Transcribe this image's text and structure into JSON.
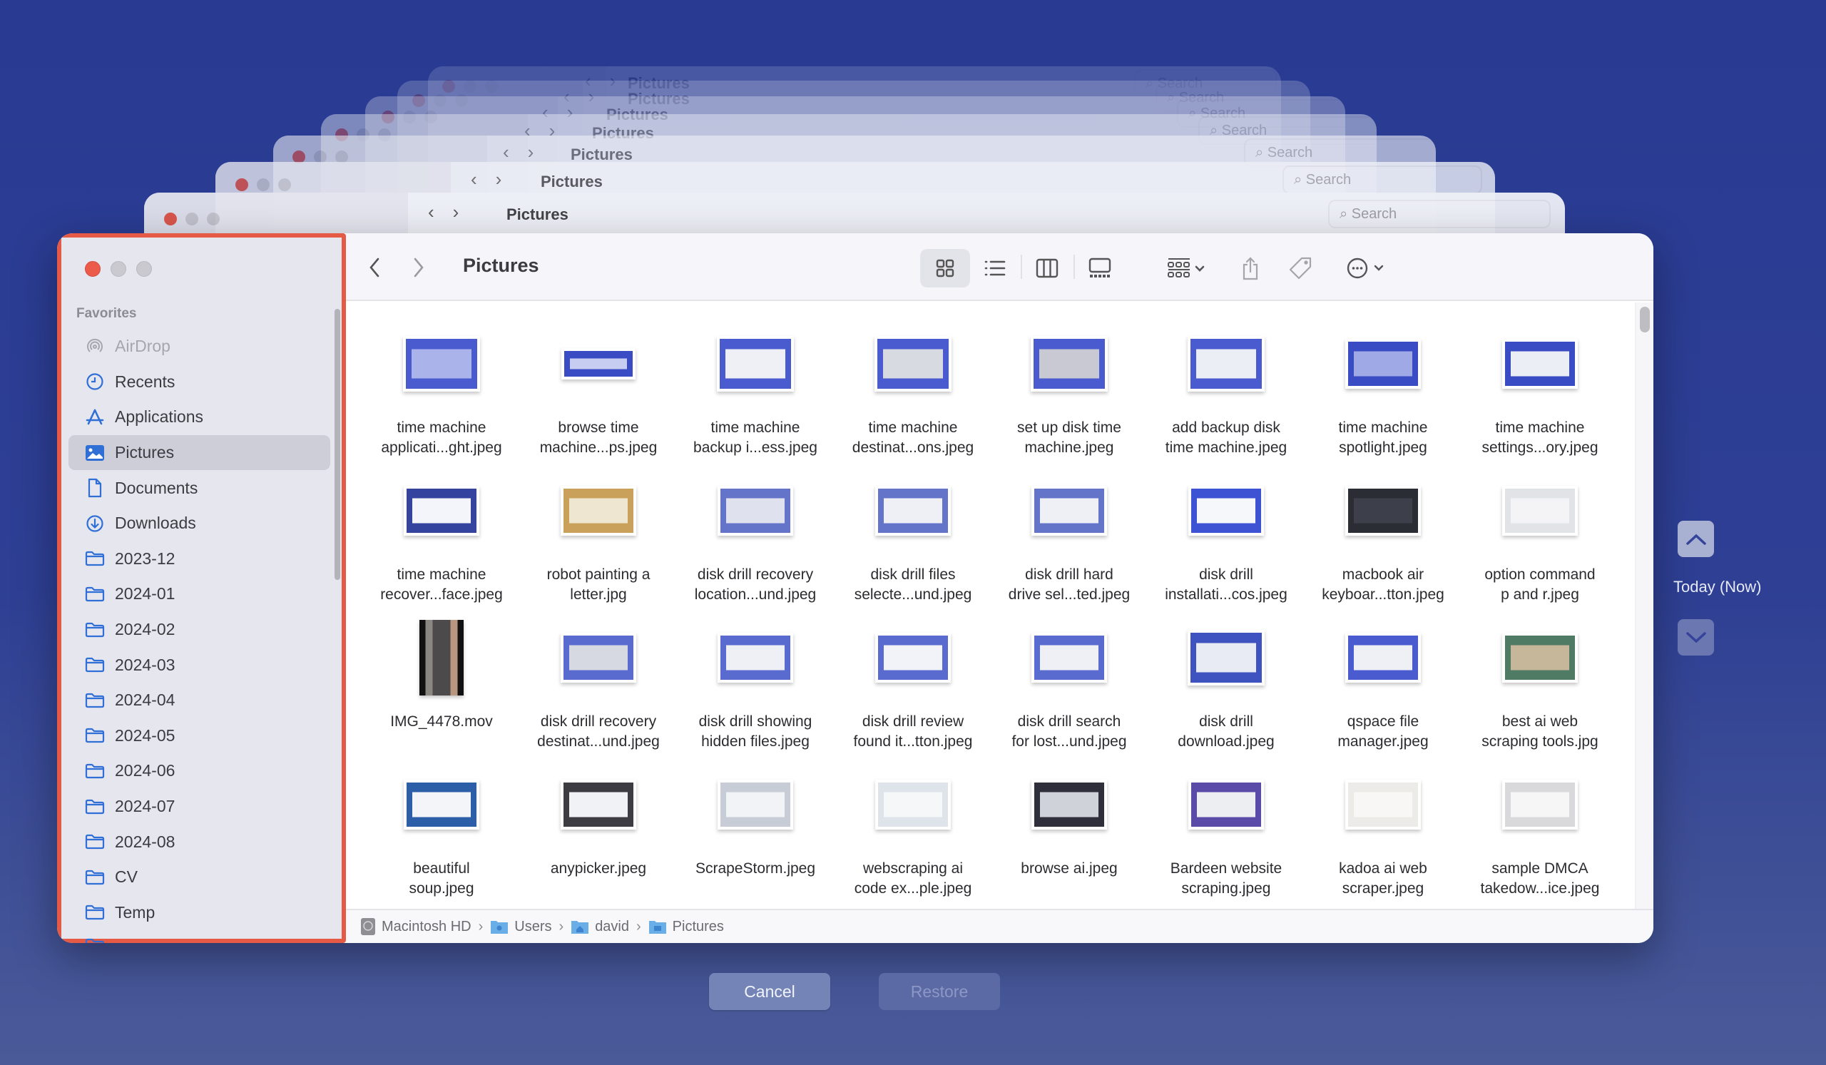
{
  "window": {
    "title": "Pictures",
    "search_placeholder": "Search",
    "search_value": ""
  },
  "sidebar": {
    "section_title": "Favorites",
    "items": [
      {
        "label": "AirDrop",
        "icon": "airdrop-icon",
        "state": "disabled"
      },
      {
        "label": "Recents",
        "icon": "clock-icon",
        "state": "normal"
      },
      {
        "label": "Applications",
        "icon": "applications-icon",
        "state": "normal"
      },
      {
        "label": "Pictures",
        "icon": "pictures-icon",
        "state": "selected"
      },
      {
        "label": "Documents",
        "icon": "document-icon",
        "state": "normal"
      },
      {
        "label": "Downloads",
        "icon": "download-icon",
        "state": "normal"
      },
      {
        "label": "2023-12",
        "icon": "folder-icon",
        "state": "normal"
      },
      {
        "label": "2024-01",
        "icon": "folder-icon",
        "state": "normal"
      },
      {
        "label": "2024-02",
        "icon": "folder-icon",
        "state": "normal"
      },
      {
        "label": "2024-03",
        "icon": "folder-icon",
        "state": "normal"
      },
      {
        "label": "2024-04",
        "icon": "folder-icon",
        "state": "normal"
      },
      {
        "label": "2024-05",
        "icon": "folder-icon",
        "state": "normal"
      },
      {
        "label": "2024-06",
        "icon": "folder-icon",
        "state": "normal"
      },
      {
        "label": "2024-07",
        "icon": "folder-icon",
        "state": "normal"
      },
      {
        "label": "2024-08",
        "icon": "folder-icon",
        "state": "normal"
      },
      {
        "label": "CV",
        "icon": "folder-icon",
        "state": "normal"
      },
      {
        "label": "Temp",
        "icon": "folder-icon",
        "state": "normal"
      }
    ]
  },
  "toolbar": {
    "back": "back-chevron-icon",
    "forward": "forward-chevron-icon",
    "views": [
      "icon-view",
      "list-view",
      "column-view",
      "gallery-view"
    ],
    "active_view": "icon-view",
    "group": "group-by-icon",
    "share": "share-icon",
    "tag": "tag-icon",
    "more": "more-actions-icon"
  },
  "files": [
    {
      "line1": "time machine",
      "line2": "applicati...ght.jpeg",
      "thumb": "#4a5bd0",
      "inner": "#aab4ea",
      "shape": "sq"
    },
    {
      "line1": "browse time",
      "line2": "machine...ps.jpeg",
      "thumb": "#3a4cc4",
      "inner": "#c6cdf0",
      "shape": "wide"
    },
    {
      "line1": "time machine",
      "line2": "backup i...ess.jpeg",
      "thumb": "#4a5bd0",
      "inner": "#eef0f6",
      "shape": "sq"
    },
    {
      "line1": "time machine",
      "line2": "destinat...ons.jpeg",
      "thumb": "#4a5bd0",
      "inner": "#d8dae2",
      "shape": "sq"
    },
    {
      "line1": "set up disk time",
      "line2": "machine.jpeg",
      "thumb": "#4a5bd0",
      "inner": "#c8c9d2",
      "shape": "sq"
    },
    {
      "line1": "add backup disk",
      "line2": "time machine.jpeg",
      "thumb": "#4a5bd0",
      "inner": "#eceef5",
      "shape": "sq"
    },
    {
      "line1": "time machine",
      "line2": "spotlight.jpeg",
      "thumb": "#3a4cc4",
      "inner": "#9ea9e6",
      "shape": "mid"
    },
    {
      "line1": "time machine",
      "line2": "settings...ory.jpeg",
      "thumb": "#3a4cc4",
      "inner": "#eceef5",
      "shape": "mid"
    },
    {
      "line1": "time machine",
      "line2": "recover...face.jpeg",
      "thumb": "#34449e",
      "inner": "#f4f5fa",
      "shape": "mid"
    },
    {
      "line1": "robot painting a",
      "line2": "letter.jpg",
      "thumb": "#c9a15a",
      "inner": "#efe6d2",
      "shape": "mid"
    },
    {
      "line1": "disk drill recovery",
      "line2": "location...und.jpeg",
      "thumb": "#6474c9",
      "inner": "#dfe2ee",
      "shape": "mid"
    },
    {
      "line1": "disk drill files",
      "line2": "selecte...und.jpeg",
      "thumb": "#6474c9",
      "inner": "#eef0f6",
      "shape": "mid"
    },
    {
      "line1": "disk drill hard",
      "line2": "drive sel...ted.jpeg",
      "thumb": "#6474c9",
      "inner": "#eef0f6",
      "shape": "mid"
    },
    {
      "line1": "disk drill",
      "line2": "installati...cos.jpeg",
      "thumb": "#3e52d4",
      "inner": "#f6f7fb",
      "shape": "mid"
    },
    {
      "line1": "macbook air",
      "line2": "keyboar...tton.jpeg",
      "thumb": "#2b2d35",
      "inner": "#3d404a",
      "shape": "mid"
    },
    {
      "line1": "option command",
      "line2": "p and r.jpeg",
      "thumb": "#e2e3e7",
      "inner": "#f4f4f6",
      "shape": "mid"
    },
    {
      "line1": "IMG_4478.mov",
      "line2": "",
      "thumb": "#2a2a2c",
      "inner": "#6a6360",
      "shape": "tall"
    },
    {
      "line1": "disk drill recovery",
      "line2": "destinat...und.jpeg",
      "thumb": "#5a6bd0",
      "inner": "#d7d9e2",
      "shape": "mid"
    },
    {
      "line1": "disk drill showing",
      "line2": "hidden files.jpeg",
      "thumb": "#5a6bd0",
      "inner": "#eef0f6",
      "shape": "mid"
    },
    {
      "line1": "disk drill review",
      "line2": "found it...tton.jpeg",
      "thumb": "#5a6bd0",
      "inner": "#f2f3f8",
      "shape": "mid"
    },
    {
      "line1": "disk drill search",
      "line2": "for lost...und.jpeg",
      "thumb": "#5a6bd0",
      "inner": "#eef0f6",
      "shape": "mid"
    },
    {
      "line1": "disk drill",
      "line2": "download.jpeg",
      "thumb": "#3e52c0",
      "inner": "#e9ebf4",
      "shape": "sq"
    },
    {
      "line1": "qspace file",
      "line2": "manager.jpeg",
      "thumb": "#4a5bd0",
      "inner": "#eef0f6",
      "shape": "mid"
    },
    {
      "line1": "best ai web",
      "line2": "scraping tools.jpg",
      "thumb": "#4f7a64",
      "inner": "#c7b79a",
      "shape": "mid"
    },
    {
      "line1": "beautiful",
      "line2": "soup.jpeg",
      "thumb": "#2d5fa8",
      "inner": "#f4f5f8",
      "shape": "mid"
    },
    {
      "line1": "anypicker.jpeg",
      "line2": "",
      "thumb": "#3c3c42",
      "inner": "#f1f2f6",
      "shape": "mid"
    },
    {
      "line1": "ScrapeStorm.jpeg",
      "line2": "",
      "thumb": "#c8ccd6",
      "inner": "#f1f3f7",
      "shape": "mid"
    },
    {
      "line1": "webscraping ai",
      "line2": "code ex...ple.jpeg",
      "thumb": "#dfe3ea",
      "inner": "#f6f7f9",
      "shape": "mid"
    },
    {
      "line1": "browse ai.jpeg",
      "line2": "",
      "thumb": "#2e2f3a",
      "inner": "#d0d2da",
      "shape": "mid"
    },
    {
      "line1": "Bardeen website",
      "line2": "scraping.jpeg",
      "thumb": "#5b4ba8",
      "inner": "#eceef2",
      "shape": "mid"
    },
    {
      "line1": "kadoa ai web",
      "line2": "scraper.jpeg",
      "thumb": "#ecebe8",
      "inner": "#f8f7f5",
      "shape": "mid"
    },
    {
      "line1": "sample DMCA",
      "line2": "takedow...ice.jpeg",
      "thumb": "#d9d9dc",
      "inner": "#f6f6f7",
      "shape": "mid"
    }
  ],
  "pathbar": {
    "crumbs": [
      "Macintosh HD",
      "Users",
      "david",
      "Pictures"
    ]
  },
  "timeline": {
    "label": "Today (Now)",
    "up": "chevron-up-icon",
    "down": "chevron-down-icon"
  },
  "dialog": {
    "cancel_label": "Cancel",
    "restore_label": "Restore",
    "restore_enabled": false
  },
  "ghost_title": "Pictures",
  "ghost_search": "Search",
  "colors": {
    "background": "#2b3d92",
    "highlight_border": "#e45a45",
    "accent_blue": "#2f6fd6",
    "close_red": "#ec5a4a"
  }
}
